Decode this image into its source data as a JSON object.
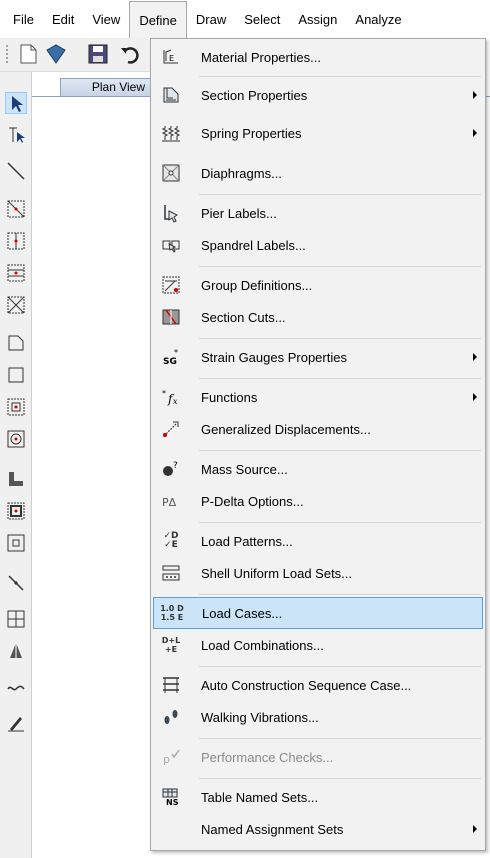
{
  "menubar": {
    "items": [
      {
        "label": "File"
      },
      {
        "label": "Edit"
      },
      {
        "label": "View"
      },
      {
        "label": "Define"
      },
      {
        "label": "Draw"
      },
      {
        "label": "Select"
      },
      {
        "label": "Assign"
      },
      {
        "label": "Analyze"
      }
    ],
    "active": "Define"
  },
  "plan_view": {
    "tab_label": "Plan View"
  },
  "define_menu": {
    "items": [
      {
        "label": "Material Properties...",
        "icon": "material-properties-icon",
        "submenu": false
      },
      {
        "label": "Section Properties",
        "icon": "section-properties-icon",
        "submenu": true
      },
      {
        "label": "Spring Properties",
        "icon": "spring-properties-icon",
        "submenu": true
      },
      {
        "label": "Diaphragms...",
        "icon": "diaphragms-icon",
        "submenu": false
      },
      {
        "label": "Pier Labels...",
        "icon": "pier-labels-icon",
        "submenu": false
      },
      {
        "label": "Spandrel Labels...",
        "icon": "spandrel-labels-icon",
        "submenu": false
      },
      {
        "label": "Group Definitions...",
        "icon": "group-definitions-icon",
        "submenu": false
      },
      {
        "label": "Section Cuts...",
        "icon": "section-cuts-icon",
        "submenu": false
      },
      {
        "label": "Strain Gauges Properties",
        "icon": "strain-gauges-icon",
        "submenu": true
      },
      {
        "label": "Functions",
        "icon": "functions-icon",
        "submenu": true
      },
      {
        "label": "Generalized Displacements...",
        "icon": "generalized-displacements-icon",
        "submenu": false
      },
      {
        "label": "Mass Source...",
        "icon": "mass-source-icon",
        "submenu": false
      },
      {
        "label": "P-Delta Options...",
        "icon": "p-delta-icon",
        "submenu": false
      },
      {
        "label": "Load Patterns...",
        "icon": "load-patterns-icon",
        "submenu": false
      },
      {
        "label": "Shell Uniform Load Sets...",
        "icon": "shell-load-sets-icon",
        "submenu": false
      },
      {
        "label": "Load Cases...",
        "icon": "load-cases-icon",
        "submenu": false,
        "highlighted": true
      },
      {
        "label": "Load Combinations...",
        "icon": "load-combinations-icon",
        "submenu": false
      },
      {
        "label": "Auto Construction Sequence Case...",
        "icon": "construction-sequence-icon",
        "submenu": false
      },
      {
        "label": "Walking Vibrations...",
        "icon": "walking-vibrations-icon",
        "submenu": false
      },
      {
        "label": "Performance Checks...",
        "icon": "performance-checks-icon",
        "submenu": false,
        "disabled": true
      },
      {
        "label": "Table Named Sets...",
        "icon": "table-named-sets-icon",
        "submenu": false
      },
      {
        "label": "Named Assignment Sets",
        "icon": "named-assignment-sets-icon",
        "submenu": true
      }
    ],
    "icon_text": {
      "strain": "SG",
      "pdelta": "PΔ",
      "loadpat_top": "✓D",
      "loadpat_bot": "✓E",
      "loadcase_top": "1.0 D",
      "loadcase_bot": "1.5 E",
      "loadcomb_top": "D+L",
      "loadcomb_bot": "+E",
      "table_ns": "NS"
    }
  },
  "colors": {
    "highlight_bg": "#cce4f7",
    "highlight_border": "#5ba0d7",
    "menu_bg": "#f2f2f2",
    "disabled_text": "#8a8a8a"
  }
}
